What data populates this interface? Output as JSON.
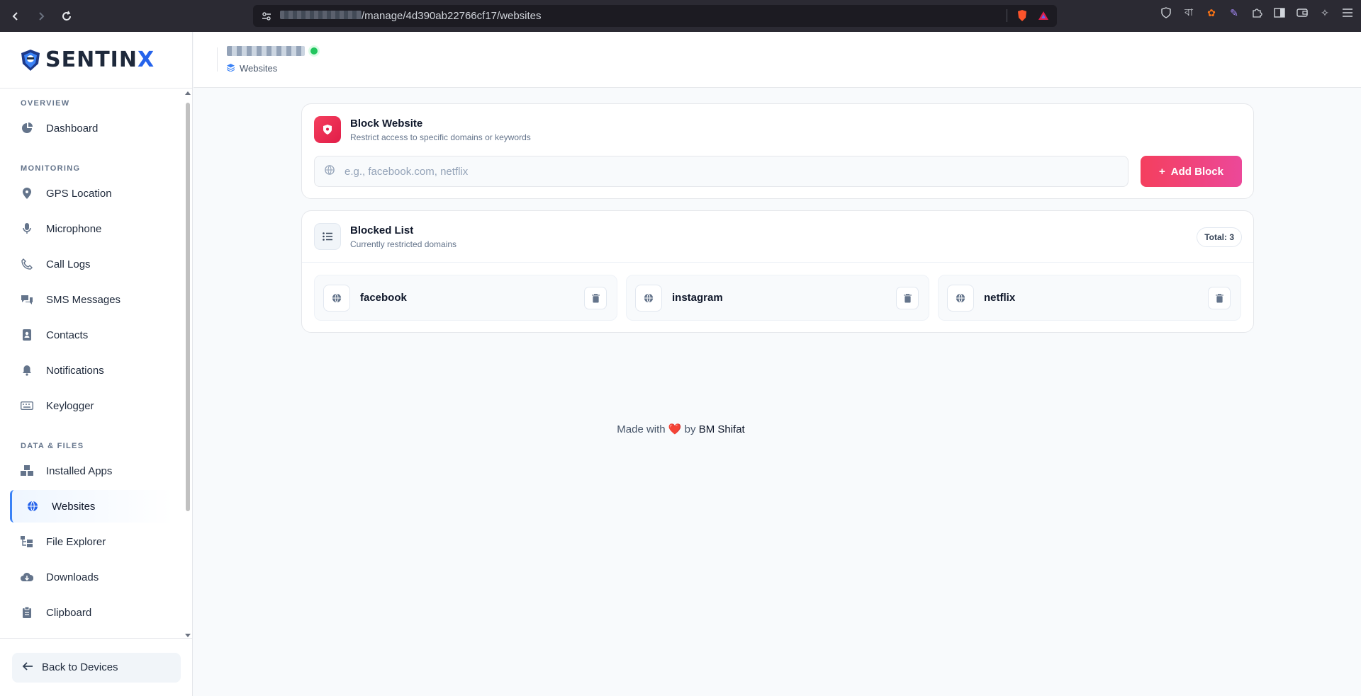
{
  "browser": {
    "url_visible": "/manage/4d390ab22766cf17/websites"
  },
  "brand": {
    "logo_text": "SENTIN",
    "logo_accent": "X"
  },
  "sidebar": {
    "sections": [
      {
        "title": "OVERVIEW"
      },
      {
        "title": "MONITORING"
      },
      {
        "title": "DATA & FILES"
      }
    ],
    "items": {
      "dashboard": "Dashboard",
      "gps": "GPS Location",
      "microphone": "Microphone",
      "call_logs": "Call Logs",
      "sms": "SMS Messages",
      "contacts": "Contacts",
      "notifications": "Notifications",
      "keylogger": "Keylogger",
      "installed_apps": "Installed Apps",
      "websites": "Websites",
      "file_explorer": "File Explorer",
      "downloads": "Downloads",
      "clipboard": "Clipboard"
    },
    "back_label": "Back to Devices"
  },
  "header": {
    "breadcrumb": "Websites"
  },
  "block_card": {
    "title": "Block Website",
    "subtitle": "Restrict access to specific domains or keywords",
    "placeholder": "e.g., facebook.com, netflix",
    "add_label": "Add Block"
  },
  "list_card": {
    "title": "Blocked List",
    "subtitle": "Currently restricted domains",
    "total": "Total: 3",
    "items": [
      "facebook",
      "instagram",
      "netflix"
    ]
  },
  "footer": {
    "prefix": "Made with",
    "heart": "❤️",
    "by": "by",
    "author": "BM Shifat"
  },
  "colors": {
    "accent": "#3b82f6",
    "danger": "#f43f5e",
    "online": "#22c55e"
  }
}
